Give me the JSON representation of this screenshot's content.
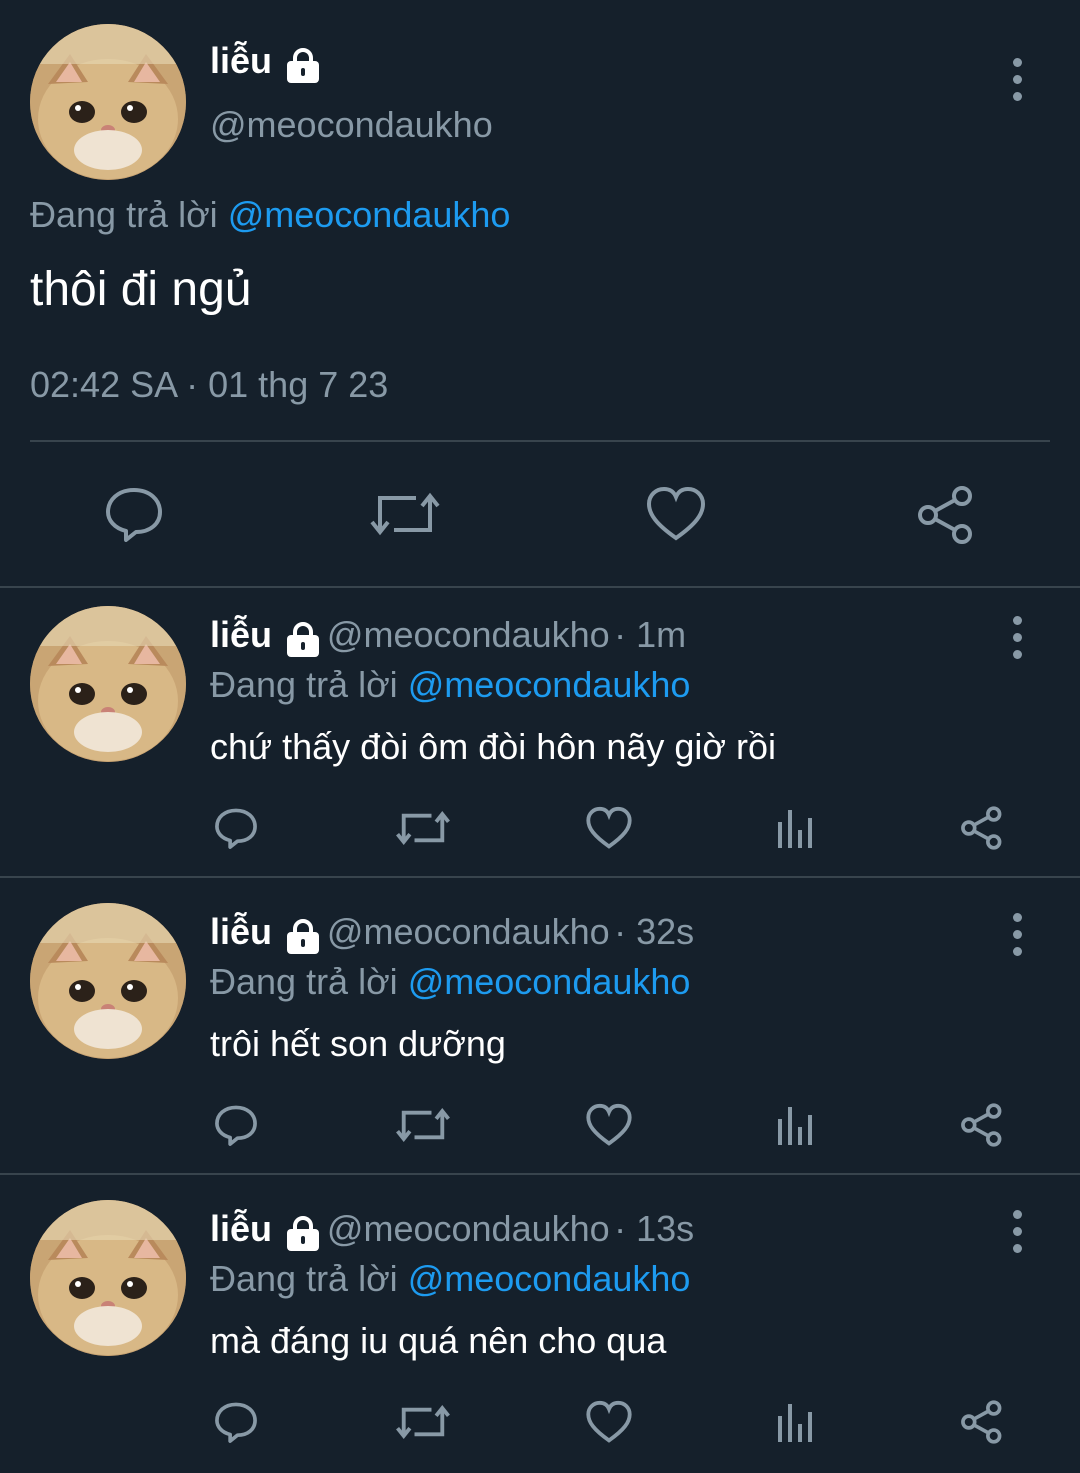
{
  "main_tweet": {
    "name": "liễu",
    "handle": "@meocondaukho",
    "reply_prefix": "Đang trả lời",
    "reply_to": "@meocondaukho",
    "text": "thôi đi ngủ",
    "timestamp": "02:42 SA · 01 thg 7 23"
  },
  "replies": [
    {
      "name": "liễu",
      "handle": "@meocondaukho",
      "time": "· 1m",
      "reply_prefix": "Đang trả lời",
      "reply_to": "@meocondaukho",
      "text": "chứ thấy đòi ôm đòi hôn nãy giờ rồi"
    },
    {
      "name": "liễu",
      "handle": "@meocondaukho",
      "time": "· 32s",
      "reply_prefix": "Đang trả lời",
      "reply_to": "@meocondaukho",
      "text": "trôi hết son dưỡng"
    },
    {
      "name": "liễu",
      "handle": "@meocondaukho",
      "time": "· 13s",
      "reply_prefix": "Đang trả lời",
      "reply_to": "@meocondaukho",
      "text": "mà đáng iu quá nên cho qua"
    }
  ],
  "icons": {
    "reply": "reply-icon",
    "retweet": "retweet-icon",
    "like": "heart-icon",
    "views": "analytics-icon",
    "share": "share-icon",
    "more": "more-vertical-icon",
    "lock": "lock-icon"
  },
  "colors": {
    "background": "#15202b",
    "text": "#ffffff",
    "muted": "#8899a6",
    "link": "#1d9bf0",
    "divider": "#38444d"
  }
}
